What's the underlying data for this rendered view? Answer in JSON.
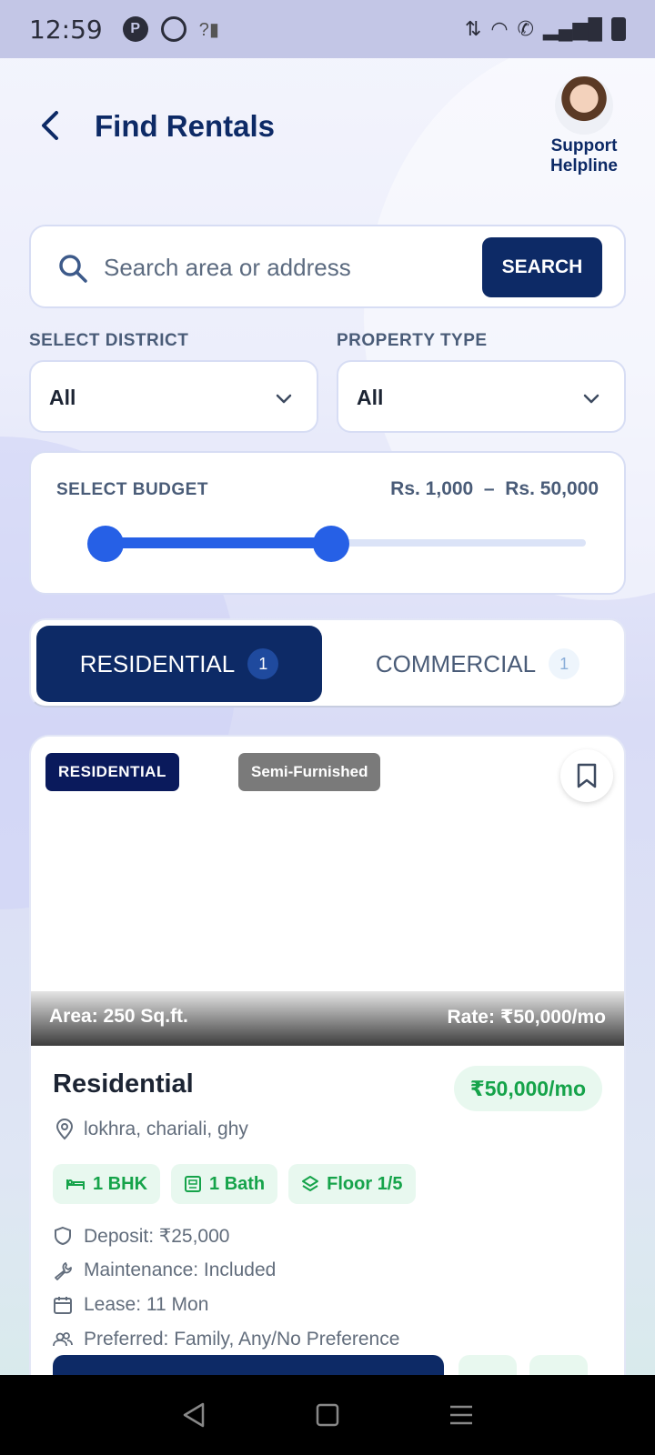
{
  "status_bar": {
    "time": "12:59"
  },
  "header": {
    "title": "Find Rentals",
    "support_label_line1": "Support",
    "support_label_line2": "Helpline"
  },
  "search": {
    "placeholder": "Search area or address",
    "button_label": "SEARCH"
  },
  "filters": {
    "district_label": "SELECT DISTRICT",
    "district_value": "All",
    "property_type_label": "PROPERTY TYPE",
    "property_type_value": "All"
  },
  "budget": {
    "label": "SELECT BUDGET",
    "range_text": "Rs. 1,000  –  Rs. 50,000",
    "min_fraction": 0.0,
    "max_fraction": 0.47
  },
  "tabs": [
    {
      "label": "RESIDENTIAL",
      "count": "1",
      "active": true
    },
    {
      "label": "COMMERCIAL",
      "count": "1",
      "active": false
    }
  ],
  "listing": {
    "type_chip": "RESIDENTIAL",
    "furnishing_chip": "Semi-Furnished",
    "area_text": "Area: 250 Sq.ft.",
    "rate_text": "Rate: ₹50,000/mo",
    "title": "Residential",
    "price": "₹50,000/mo",
    "location": "lokhra, chariali, ghy",
    "tags": [
      "1 BHK",
      "1 Bath",
      "Floor 1/5"
    ],
    "deposit": "Deposit: ₹25,000",
    "maintenance": "Maintenance: Included",
    "lease": "Lease: 11 Mon",
    "preferred": "Preferred: Family, Any/No Preference"
  },
  "colors": {
    "primary": "#0d2a66",
    "accent_blue": "#2660e6",
    "green": "#15a34a",
    "green_bg": "#e8f8ef"
  }
}
